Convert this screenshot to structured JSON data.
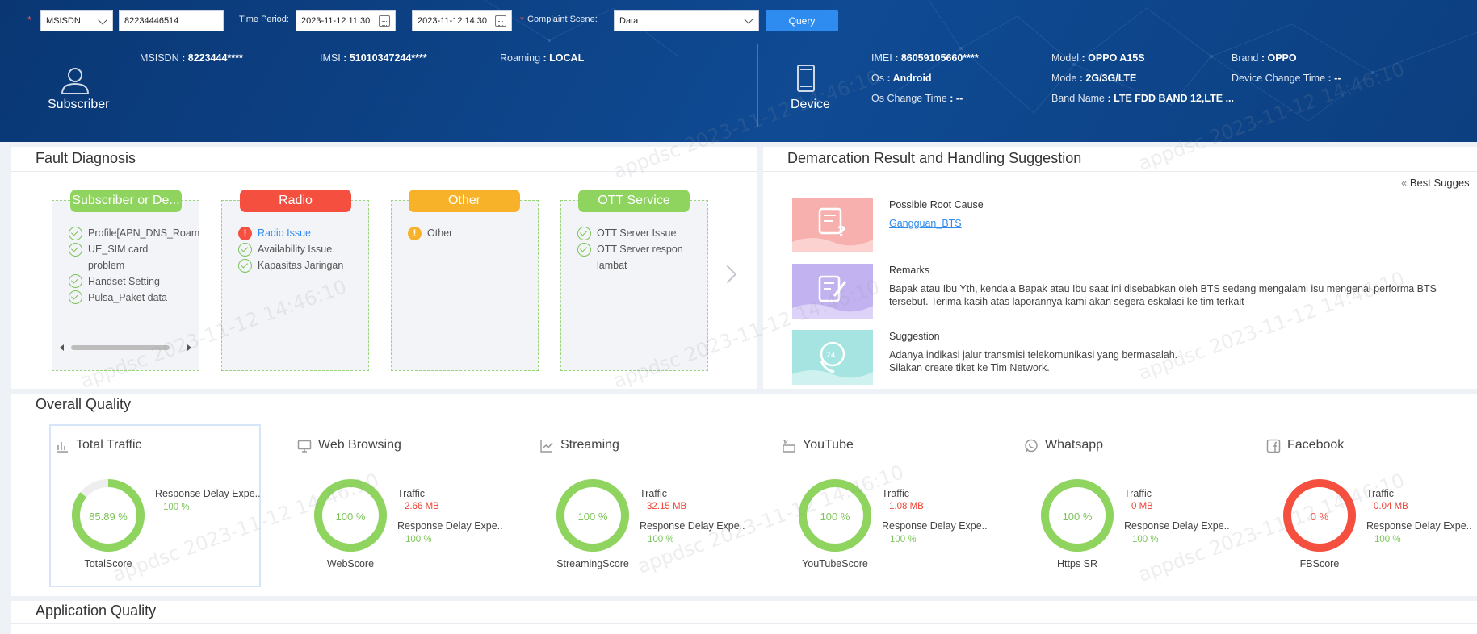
{
  "query": {
    "type_select": "MSISDN",
    "msisdn_value": "82234446514",
    "time_period_label": "Time Period:",
    "start_time": "2023-11-12 11:30",
    "end_time": "2023-11-12 14:30",
    "complaint_scene_label": "Complaint Scene:",
    "complaint_scene": "Data",
    "query_button": "Query"
  },
  "subscriber": {
    "title": "Subscriber",
    "msisdn_key": "MSISDN",
    "msisdn_val": ": 8223444****",
    "imsi_key": "IMSI",
    "imsi_val": ": 51010347244****",
    "roaming_key": "Roaming",
    "roaming_val": ": LOCAL"
  },
  "device": {
    "title": "Device",
    "imei_key": "IMEI",
    "imei_val": ": 86059105660****",
    "model_key": "Model",
    "model_val": ": OPPO A15S",
    "brand_key": "Brand",
    "brand_val": ": OPPO",
    "os_key": "Os",
    "os_val": ": Android",
    "mode_key": "Mode",
    "mode_val": ": 2G/3G/LTE",
    "device_change_key": "Device Change Time",
    "device_change_val": ": --",
    "os_change_key": "Os Change Time",
    "os_change_val": ": --",
    "band_key": "Band Name",
    "band_val": ": LTE FDD BAND 12,LTE ..."
  },
  "fault": {
    "title": "Fault Diagnosis",
    "cards": [
      {
        "title": "Subscriber or De...",
        "color": "#8ed45f",
        "items": [
          "Profile[APN_DNS_Roam",
          "UE_SIM card",
          "problem",
          "Handset Setting",
          "Pulsa_Paket data"
        ]
      },
      {
        "title": "Radio",
        "color": "#f5503f",
        "items": [
          "Radio Issue",
          "Availability Issue",
          "Kapasitas Jaringan"
        ]
      },
      {
        "title": "Other",
        "color": "#f8b22a",
        "items": [
          "Other"
        ]
      },
      {
        "title": "OTT Service",
        "color": "#8ed45f",
        "items": [
          "OTT Server Issue",
          "OTT Server respon",
          "lambat"
        ]
      }
    ]
  },
  "demarcation": {
    "title": "Demarcation Result and Handling Suggestion",
    "best_suggestion": "Best Sugges",
    "root_cause_label": "Possible Root Cause",
    "root_cause_link": "Gangguan_BTS",
    "remarks_label": "Remarks",
    "remarks_line1": "Bapak atau Ibu Yth, kendala Bapak atau Ibu saat ini disebabkan oleh BTS sedang mengalami isu mengenai performa BTS",
    "remarks_line2": "tersebut. Terima kasih atas laporannya kami akan segera eskalasi ke tim terkait",
    "suggestion_label": "Suggestion",
    "suggestion_line1": "Adanya indikasi jalur transmisi telekomunikasi yang bermasalah.",
    "suggestion_line2": "Silakan create tiket ke Tim Network."
  },
  "overall": {
    "title": "Overall Quality",
    "cards": [
      {
        "name": "Total Traffic",
        "icon": "bar-chart-icon",
        "score_label": "TotalScore",
        "score": "85.89 %",
        "pct": 85.89,
        "color": "#8ed45f",
        "traffic_label": "",
        "traffic": "",
        "delay_label": "Response Delay Expe...",
        "delay": "100 %"
      },
      {
        "name": "Web Browsing",
        "icon": "monitor-icon",
        "score_label": "WebScore",
        "score": "100 %",
        "pct": 100,
        "color": "#8ed45f",
        "traffic_label": "Traffic",
        "traffic": "2.66 MB",
        "delay_label": "Response Delay Expe...",
        "delay": "100 %"
      },
      {
        "name": "Streaming",
        "icon": "line-chart-icon",
        "score_label": "StreamingScore",
        "score": "100 %",
        "pct": 100,
        "color": "#8ed45f",
        "traffic_label": "Traffic",
        "traffic": "32.15 MB",
        "delay_label": "Response Delay Expe...",
        "delay": "100 %"
      },
      {
        "name": "YouTube",
        "icon": "youtube-icon",
        "score_label": "YouTubeScore",
        "score": "100 %",
        "pct": 100,
        "color": "#8ed45f",
        "traffic_label": "Traffic",
        "traffic": "1.08 MB",
        "delay_label": "Response Delay Expe...",
        "delay": "100 %"
      },
      {
        "name": "Whatsapp",
        "icon": "whatsapp-icon",
        "score_label": "Https SR",
        "score": "100 %",
        "pct": 100,
        "color": "#8ed45f",
        "traffic_label": "Traffic",
        "traffic": "0 MB",
        "delay_label": "Response Delay Expe...",
        "delay": "100 %"
      },
      {
        "name": "Facebook",
        "icon": "facebook-icon",
        "score_label": "FBScore",
        "score": "0 %",
        "pct": 100,
        "color": "#f5503f",
        "traffic_label": "Traffic",
        "traffic": "0.04 MB",
        "delay_label": "Response Delay Expe...",
        "delay": "100 %"
      }
    ]
  },
  "application": {
    "title": "Application Quality"
  },
  "watermark": "appdsc 2023-11-12 14:46:10"
}
